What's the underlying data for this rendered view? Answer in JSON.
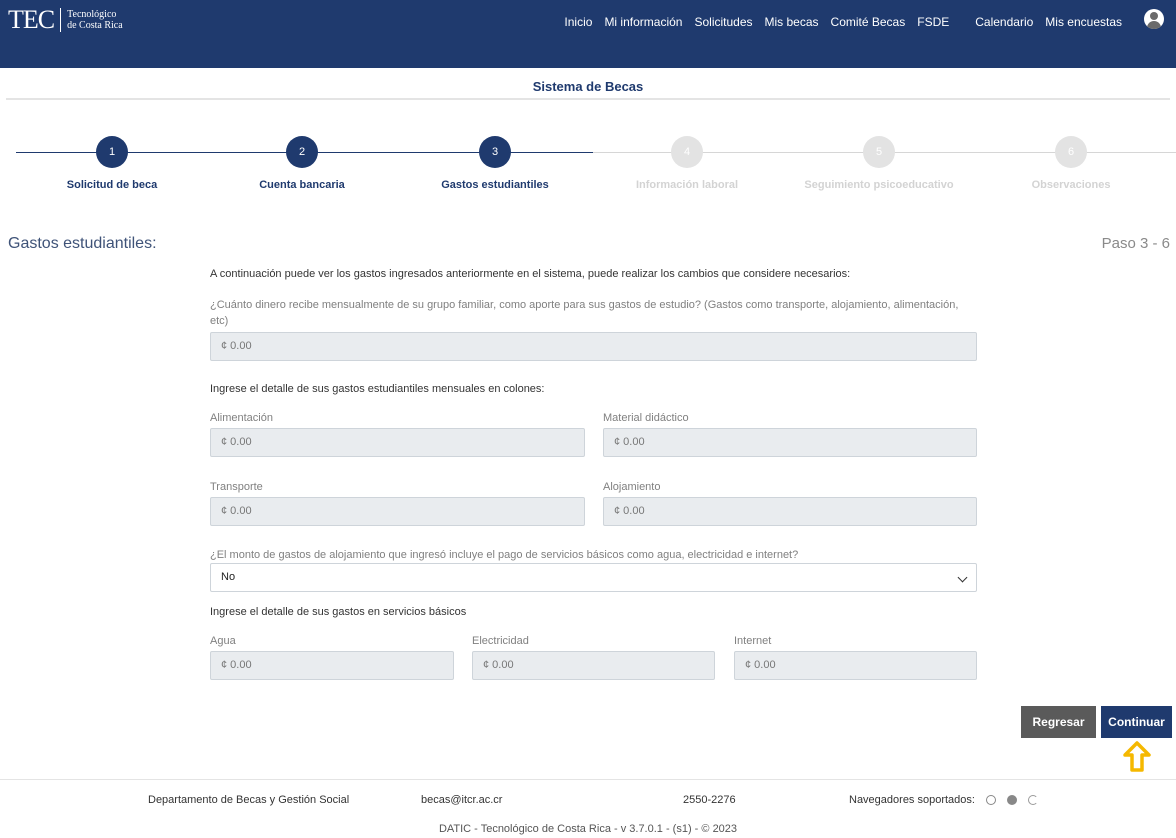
{
  "header": {
    "logo_tec": "TEC",
    "logo_line1": "Tecnológico",
    "logo_line2": "de Costa Rica",
    "nav": [
      "Inicio",
      "Mi información",
      "Solicitudes",
      "Mis becas",
      "Comité Becas",
      "FSDE",
      "Calendario",
      "Mis encuestas"
    ]
  },
  "subtitle": "Sistema de Becas",
  "stepper": {
    "steps": [
      {
        "number": "1",
        "label": "Solicitud de beca",
        "state": "done"
      },
      {
        "number": "2",
        "label": "Cuenta bancaria",
        "state": "done"
      },
      {
        "number": "3",
        "label": "Gastos estudiantiles",
        "state": "done"
      },
      {
        "number": "4",
        "label": "Información laboral",
        "state": "todo"
      },
      {
        "number": "5",
        "label": "Seguimiento psicoeducativo",
        "state": "todo"
      },
      {
        "number": "6",
        "label": "Observaciones",
        "state": "todo"
      }
    ]
  },
  "section": {
    "title": "Gastos estudiantiles:",
    "step_count": "Paso 3 - 6"
  },
  "form": {
    "intro": "A continuación puede ver los gastos ingresados anteriormente en el sistema, puede realizar los cambios que considere necesarios:",
    "family_question": "¿Cuánto dinero recibe mensualmente de su grupo familiar, como aporte para sus gastos de estudio? (Gastos como transporte, alojamiento, alimentación, etc)",
    "family_value": "¢ 0.00",
    "detail_title": "Ingrese el detalle de sus gastos estudiantiles mensuales en colones:",
    "alimentacion_label": "Alimentación",
    "alimentacion_value": "¢ 0.00",
    "material_label": "Material didáctico",
    "material_value": "¢ 0.00",
    "transporte_label": "Transporte",
    "transporte_value": "¢ 0.00",
    "alojamiento_label": "Alojamiento",
    "alojamiento_value": "¢ 0.00",
    "servicios_question": "¿El monto de gastos de alojamiento que ingresó incluye el pago de servicios básicos como agua, electricidad e internet?",
    "servicios_selected": "No",
    "basic_title": "Ingrese el detalle de sus gastos en servicios básicos",
    "agua_label": "Agua",
    "agua_value": "¢ 0.00",
    "electricidad_label": "Electricidad",
    "electricidad_value": "¢ 0.00",
    "internet_label": "Internet",
    "internet_value": "¢ 0.00"
  },
  "buttons": {
    "back": "Regresar",
    "next": "Continuar"
  },
  "footer": {
    "department": "Departamento de Becas y Gestión Social",
    "email": "becas@itcr.ac.cr",
    "phone": "2550-2276",
    "browsers_label": "Navegadores soportados:",
    "browser_icons": [
      "chrome-icon",
      "firefox-icon",
      "edge-icon"
    ],
    "copyright": "DATIC - Tecnológico de Costa Rica - v 3.7.0.1 - (s1) - © 2023"
  },
  "colors": {
    "primary": "#1f3a6e",
    "inactive_step": "#e3e3e3",
    "arrow": "#f5b800"
  }
}
